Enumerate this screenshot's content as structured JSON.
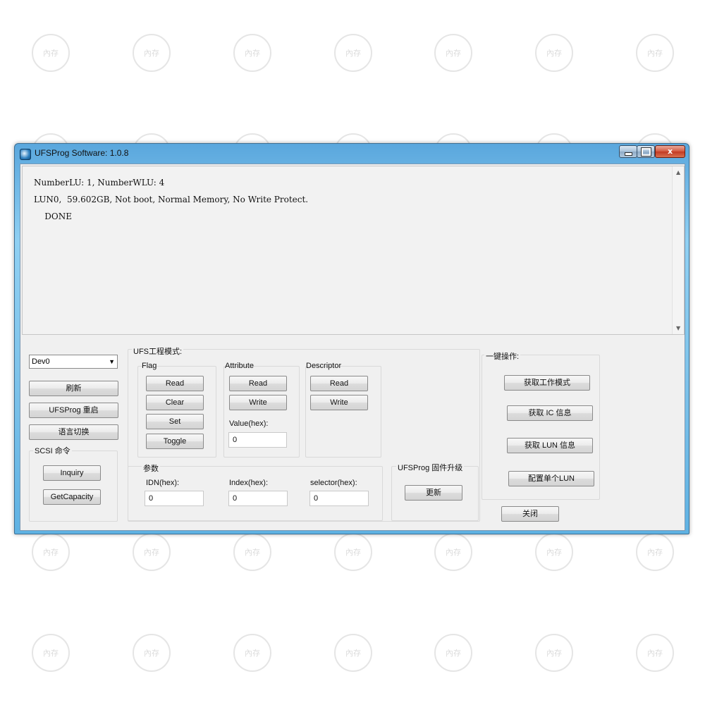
{
  "window": {
    "title": "UFSProg Software: 1.0.8",
    "close_glyph": "x"
  },
  "log": {
    "lines": [
      "NumberLU: 1, NumberWLU: 4",
      "LUN0,  59.602GB, Not boot, Normal Memory, No Write Protect.",
      "    DONE"
    ]
  },
  "left_panel": {
    "device": "Dev0",
    "refresh": "刷新",
    "restart": "UFSProg 重启",
    "language": "语言切换",
    "scsi_group": "SCSI 命令",
    "inquiry": "Inquiry",
    "get_capacity": "GetCapacity"
  },
  "ufs_engineering": {
    "title": "UFS工程模式:",
    "flag": {
      "label": "Flag",
      "read": "Read",
      "clear": "Clear",
      "set": "Set",
      "toggle": "Toggle"
    },
    "attribute": {
      "label": "Attribute",
      "read": "Read",
      "write": "Write",
      "value_label": "Value(hex):",
      "value": "0"
    },
    "descriptor": {
      "label": "Descriptor",
      "read": "Read",
      "write": "Write"
    },
    "params": {
      "label": "参数",
      "idn_label": "IDN(hex):",
      "idn_value": "0",
      "index_label": "Index(hex):",
      "index_value": "0",
      "selector_label": "selector(hex):",
      "selector_value": "0"
    }
  },
  "firmware": {
    "label": "UFSProg 固件升级",
    "update": "更新"
  },
  "one_click": {
    "title": "一键操作:",
    "get_work_mode": "获取工作模式",
    "get_ic_info": "获取 IC 信息",
    "get_lun_info": "获取 LUN 信息",
    "config_single_lun": "配置单个LUN"
  },
  "close_button": "关闭",
  "watermark": "內存"
}
